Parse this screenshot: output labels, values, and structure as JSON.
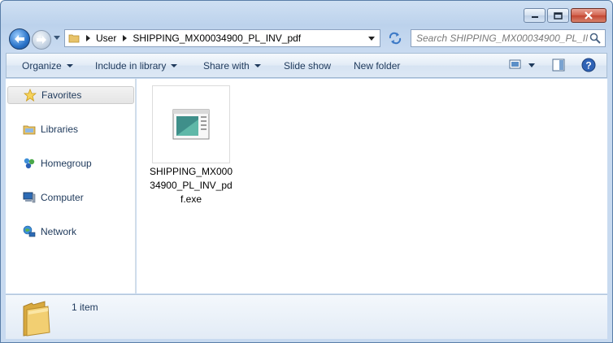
{
  "window": {
    "caption_buttons": [
      "minimize-button",
      "maximize-button",
      "close-button"
    ]
  },
  "address": {
    "segments": [
      "User",
      "SHIPPING_MX00034900_PL_INV_pdf"
    ]
  },
  "search": {
    "placeholder": "Search SHIPPING_MX00034900_PL_IN..."
  },
  "toolbar": {
    "organize": "Organize",
    "include_in_library": "Include in library",
    "share_with": "Share with",
    "slide_show": "Slide show",
    "new_folder": "New folder"
  },
  "nav": {
    "favorites": "Favorites",
    "libraries": "Libraries",
    "homegroup": "Homegroup",
    "computer": "Computer",
    "network": "Network"
  },
  "files": [
    {
      "name": "SHIPPING_MX00034900_PL_INV_pdf.exe",
      "icon": "exe-window-icon"
    }
  ],
  "details": {
    "count_text": "1 item"
  },
  "colors": {
    "frame": "#bcd2ec",
    "accent_text": "#1e395b",
    "close_button": "#c34531"
  }
}
